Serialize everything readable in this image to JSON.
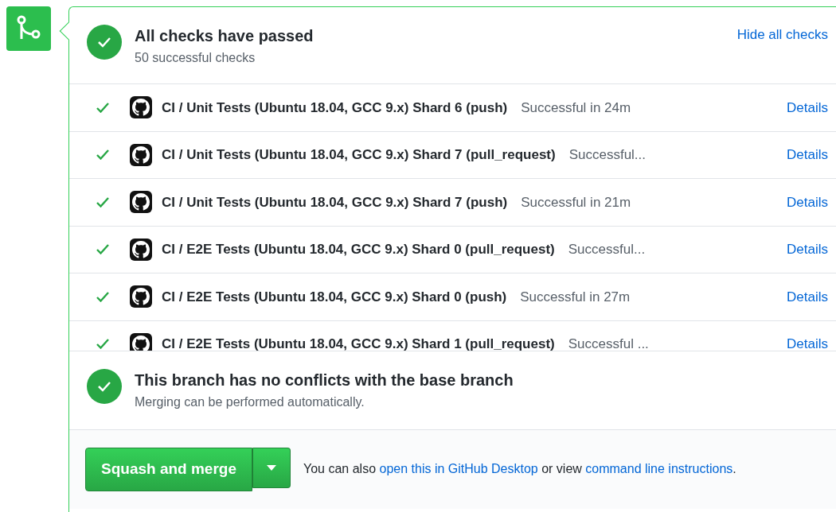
{
  "checks_header": {
    "title": "All checks have passed",
    "subtitle": "50 successful checks",
    "toggle_link": "Hide all checks"
  },
  "checks": [
    {
      "name": "CI / Unit Tests (Ubuntu 18.04, GCC 9.x) Shard 6 (push)",
      "status": "Successful in 24m",
      "link": "Details",
      "passed": true
    },
    {
      "name": "CI / Unit Tests (Ubuntu 18.04, GCC 9.x) Shard 7 (pull_request)",
      "status": "Successful...",
      "link": "Details",
      "passed": true
    },
    {
      "name": "CI / Unit Tests (Ubuntu 18.04, GCC 9.x) Shard 7 (push)",
      "status": "Successful in 21m",
      "link": "Details",
      "passed": true
    },
    {
      "name": "CI / E2E Tests (Ubuntu 18.04, GCC 9.x) Shard 0 (pull_request)",
      "status": "Successful...",
      "link": "Details",
      "passed": true
    },
    {
      "name": "CI / E2E Tests (Ubuntu 18.04, GCC 9.x) Shard 0 (push)",
      "status": "Successful in 27m",
      "link": "Details",
      "passed": true
    },
    {
      "name": "CI / E2E Tests (Ubuntu 18.04, GCC 9.x) Shard 1 (pull_request)",
      "status": "Successful ...",
      "link": "Details",
      "passed": true
    }
  ],
  "conflicts": {
    "title": "This branch has no conflicts with the base branch",
    "subtitle": "Merging can be performed automatically."
  },
  "merge": {
    "button": "Squash and merge",
    "text_before": "You can also",
    "link_desktop": "open this in GitHub Desktop",
    "text_middle": "or view",
    "link_cli": "command line instructions",
    "text_end": "."
  }
}
